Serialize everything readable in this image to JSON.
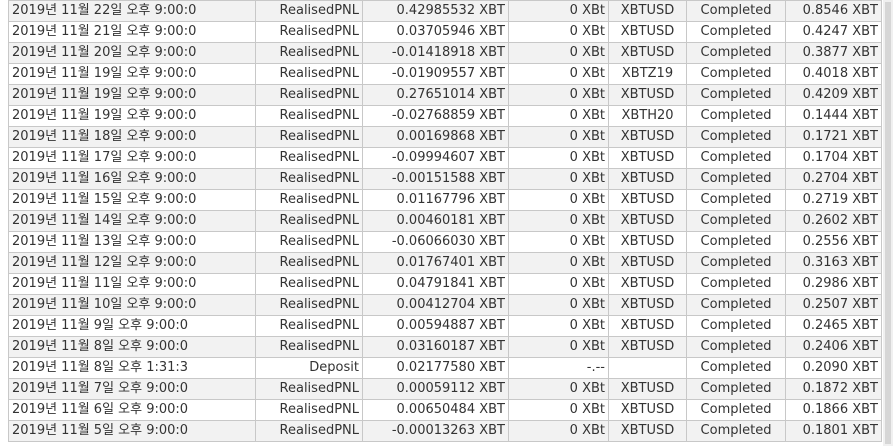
{
  "rows": [
    {
      "time": "2019년 11월 22일 오후 9:00:0",
      "type": "RealisedPNL",
      "amount": "0.42985532 XBT",
      "fee": "0 XBt",
      "symbol": "XBTUSD",
      "status": "Completed",
      "balance": "0.8546 XBT"
    },
    {
      "time": "2019년 11월 21일 오후 9:00:0",
      "type": "RealisedPNL",
      "amount": "0.03705946 XBT",
      "fee": "0 XBt",
      "symbol": "XBTUSD",
      "status": "Completed",
      "balance": "0.4247 XBT"
    },
    {
      "time": "2019년 11월 20일 오후 9:00:0",
      "type": "RealisedPNL",
      "amount": "-0.01418918 XBT",
      "fee": "0 XBt",
      "symbol": "XBTUSD",
      "status": "Completed",
      "balance": "0.3877 XBT"
    },
    {
      "time": "2019년 11월 19일 오후 9:00:0",
      "type": "RealisedPNL",
      "amount": "-0.01909557 XBT",
      "fee": "0 XBt",
      "symbol": "XBTZ19",
      "status": "Completed",
      "balance": "0.4018 XBT"
    },
    {
      "time": "2019년 11월 19일 오후 9:00:0",
      "type": "RealisedPNL",
      "amount": "0.27651014 XBT",
      "fee": "0 XBt",
      "symbol": "XBTUSD",
      "status": "Completed",
      "balance": "0.4209 XBT"
    },
    {
      "time": "2019년 11월 19일 오후 9:00:0",
      "type": "RealisedPNL",
      "amount": "-0.02768859 XBT",
      "fee": "0 XBt",
      "symbol": "XBTH20",
      "status": "Completed",
      "balance": "0.1444 XBT"
    },
    {
      "time": "2019년 11월 18일 오후 9:00:0",
      "type": "RealisedPNL",
      "amount": "0.00169868 XBT",
      "fee": "0 XBt",
      "symbol": "XBTUSD",
      "status": "Completed",
      "balance": "0.1721 XBT"
    },
    {
      "time": "2019년 11월 17일 오후 9:00:0",
      "type": "RealisedPNL",
      "amount": "-0.09994607 XBT",
      "fee": "0 XBt",
      "symbol": "XBTUSD",
      "status": "Completed",
      "balance": "0.1704 XBT"
    },
    {
      "time": "2019년 11월 16일 오후 9:00:0",
      "type": "RealisedPNL",
      "amount": "-0.00151588 XBT",
      "fee": "0 XBt",
      "symbol": "XBTUSD",
      "status": "Completed",
      "balance": "0.2704 XBT"
    },
    {
      "time": "2019년 11월 15일 오후 9:00:0",
      "type": "RealisedPNL",
      "amount": "0.01167796 XBT",
      "fee": "0 XBt",
      "symbol": "XBTUSD",
      "status": "Completed",
      "balance": "0.2719 XBT"
    },
    {
      "time": "2019년 11월 14일 오후 9:00:0",
      "type": "RealisedPNL",
      "amount": "0.00460181 XBT",
      "fee": "0 XBt",
      "symbol": "XBTUSD",
      "status": "Completed",
      "balance": "0.2602 XBT"
    },
    {
      "time": "2019년 11월 13일 오후 9:00:0",
      "type": "RealisedPNL",
      "amount": "-0.06066030 XBT",
      "fee": "0 XBt",
      "symbol": "XBTUSD",
      "status": "Completed",
      "balance": "0.2556 XBT"
    },
    {
      "time": "2019년 11월 12일 오후 9:00:0",
      "type": "RealisedPNL",
      "amount": "0.01767401 XBT",
      "fee": "0 XBt",
      "symbol": "XBTUSD",
      "status": "Completed",
      "balance": "0.3163 XBT"
    },
    {
      "time": "2019년 11월 11일 오후 9:00:0",
      "type": "RealisedPNL",
      "amount": "0.04791841 XBT",
      "fee": "0 XBt",
      "symbol": "XBTUSD",
      "status": "Completed",
      "balance": "0.2986 XBT"
    },
    {
      "time": "2019년 11월 10일 오후 9:00:0",
      "type": "RealisedPNL",
      "amount": "0.00412704 XBT",
      "fee": "0 XBt",
      "symbol": "XBTUSD",
      "status": "Completed",
      "balance": "0.2507 XBT"
    },
    {
      "time": "2019년 11월 9일 오후 9:00:0",
      "type": "RealisedPNL",
      "amount": "0.00594887 XBT",
      "fee": "0 XBt",
      "symbol": "XBTUSD",
      "status": "Completed",
      "balance": "0.2465 XBT"
    },
    {
      "time": "2019년 11월 8일 오후 9:00:0",
      "type": "RealisedPNL",
      "amount": "0.03160187 XBT",
      "fee": "0 XBt",
      "symbol": "XBTUSD",
      "status": "Completed",
      "balance": "0.2406 XBT"
    },
    {
      "time": "2019년 11월 8일 오후 1:31:3",
      "type": "Deposit",
      "amount": "0.02177580 XBT",
      "fee": "-.--",
      "symbol": "",
      "status": "Completed",
      "balance": "0.2090 XBT"
    },
    {
      "time": "2019년 11월 7일 오후 9:00:0",
      "type": "RealisedPNL",
      "amount": "0.00059112 XBT",
      "fee": "0 XBt",
      "symbol": "XBTUSD",
      "status": "Completed",
      "balance": "0.1872 XBT"
    },
    {
      "time": "2019년 11월 6일 오후 9:00:0",
      "type": "RealisedPNL",
      "amount": "0.00650484 XBT",
      "fee": "0 XBt",
      "symbol": "XBTUSD",
      "status": "Completed",
      "balance": "0.1866 XBT"
    },
    {
      "time": "2019년 11월 5일 오후 9:00:0",
      "type": "RealisedPNL",
      "amount": "-0.00013263 XBT",
      "fee": "0 XBt",
      "symbol": "XBTUSD",
      "status": "Completed",
      "balance": "0.1801 XBT"
    }
  ]
}
